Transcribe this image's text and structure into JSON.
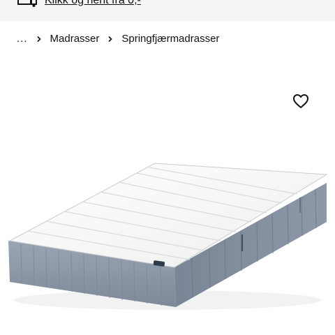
{
  "banner": {
    "link_text": "Klikk og hent fra 0,-",
    "icon": "store-pickup-icon"
  },
  "breadcrumb": {
    "ellipsis": "...",
    "items": [
      "Madrasser",
      "Springfjærmadrasser"
    ],
    "separator_icon": "chevron-right-icon"
  },
  "product": {
    "favourite_icon": "heart-outline-icon",
    "colors": {
      "mattress_top": "#f7f7f5",
      "mattress_side": "#8e99a8",
      "mattress_side_dark": "#6f7a89"
    }
  }
}
